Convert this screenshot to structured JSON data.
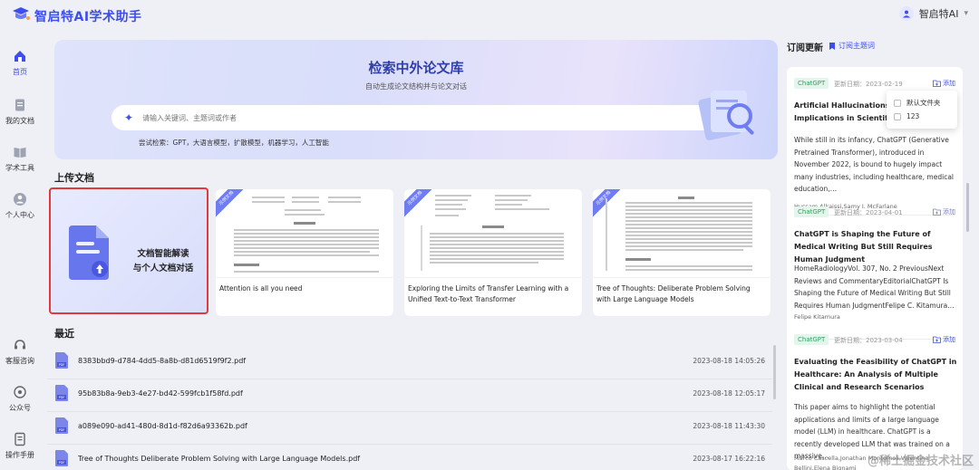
{
  "app": {
    "title": "智启特AI学术助手"
  },
  "user": {
    "name": "智启特AI"
  },
  "nav": [
    {
      "label": "首页",
      "icon": "home-icon"
    },
    {
      "label": "我的文档",
      "icon": "document-icon"
    },
    {
      "label": "学术工具",
      "icon": "book-icon"
    },
    {
      "label": "个人中心",
      "icon": "user-icon"
    },
    {
      "label": "客服咨询",
      "icon": "headset-icon"
    },
    {
      "label": "公众号",
      "icon": "wechat-icon"
    },
    {
      "label": "操作手册",
      "icon": "manual-icon"
    }
  ],
  "hero": {
    "title": "检索中外论文库",
    "subtitle": "自动生成论文结构并与论文对话",
    "search_placeholder": "请输入关键词、主题词或作者",
    "hint": "尝试检索：GPT，大语言模型，扩散模型，机器学习，人工智能"
  },
  "upload": {
    "section_title": "上传文档",
    "card_text_line1": "文档智能解读",
    "card_text_line2": "与个人文档对话"
  },
  "examples": [
    {
      "ribbon": "示例文档",
      "name": "Attention is all you need"
    },
    {
      "ribbon": "示例文档",
      "name": "Exploring the Limits of Transfer Learning with a Unified Text-to-Text Transformer"
    },
    {
      "ribbon": "示例文档",
      "name": "Tree of Thoughts: Deliberate Problem Solving with Large Language Models"
    }
  ],
  "recent": {
    "section_title": "最近",
    "rows": [
      {
        "name": "8383bbd9-d784-4dd5-8a8b-d81d6519f9f2.pdf",
        "date": "2023-08-18 14:05:26"
      },
      {
        "name": "95b83b8a-9eb3-4e27-bd42-599fcb1f58fd.pdf",
        "date": "2023-08-18 12:05:17"
      },
      {
        "name": "a089e090-ad41-480d-8d1d-f82d6a93362b.pdf",
        "date": "2023-08-18 11:43:30"
      },
      {
        "name": "Tree of Thoughts Deliberate Problem Solving with Large Language Models.pdf",
        "date": "2023-08-17 16:22:16"
      }
    ]
  },
  "subscription": {
    "title": "订阅更新",
    "link": "订阅主题词",
    "items": [
      {
        "tag": "ChatGPT",
        "date": "更新日期：2023-02-19",
        "add": "添加",
        "title": "Artificial Hallucinations in C… Implications in Scientific W…",
        "desc": "While still in its infancy, ChatGPT (Generative Pretrained Transformer), introduced in November 2022, is bound to hugely impact many industries, including healthcare, medical education,…",
        "authors": "Hussam Alkaissi,Samy I. McFarlane"
      },
      {
        "tag": "ChatGPT",
        "date": "更新日期：2023-04-01",
        "add": "添加",
        "title": "ChatGPT is Shaping the Future of Medical Writing But Still Requires Human Judgment",
        "desc": "HomeRadiologyVol. 307, No. 2 PreviousNext Reviews and CommentaryEditorialChatGPT Is Shaping the Future of Medical Writing But Still Requires Human JudgmentFelipe C. Kitamura…",
        "authors": "Felipe Kitamura"
      },
      {
        "tag": "ChatGPT",
        "date": "更新日期：2023-03-04",
        "add": "添加",
        "title": "Evaluating the Feasibility of ChatGPT in Healthcare: An Analysis of Multiple Clinical and Research Scenarios",
        "desc": "This paper aims to highlight the potential applications and limits of a large language model (LLM) in healthcare. ChatGPT is a recently developed LLM that was trained on a massive…",
        "authors": "Marco Cascella,Jonathan Montomoli,Valentina Bellini,Elena Bignami"
      }
    ]
  },
  "dropdown": {
    "options": [
      "默认文件夹",
      "123"
    ]
  },
  "watermark": "@稀土掘金技术社区",
  "colors": {
    "accent": "#3d4eea",
    "highlight_border": "#e03a3a",
    "tag_bg": "#e3f6ec",
    "tag_fg": "#2f9e61"
  }
}
